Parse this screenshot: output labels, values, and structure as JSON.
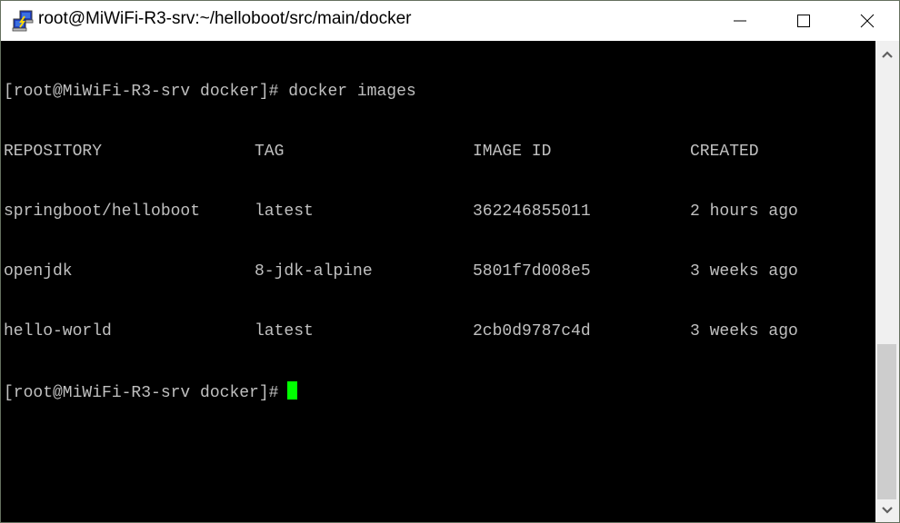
{
  "window": {
    "title": "root@MiWiFi-R3-srv:~/helloboot/src/main/docker",
    "app_icon": "network-computers-icon",
    "controls": {
      "minimize": "minimize-icon",
      "maximize": "maximize-icon",
      "close": "close-icon"
    }
  },
  "terminal": {
    "colors": {
      "background": "#000000",
      "text": "#c0c0c0",
      "cursor": "#00ff00"
    },
    "command_line": {
      "prompt": "[root@MiWiFi-R3-srv docker]#",
      "command": "docker images"
    },
    "table": {
      "headers": [
        "REPOSITORY",
        "TAG",
        "IMAGE ID",
        "CREATED"
      ],
      "rows": [
        [
          "springboot/helloboot",
          "latest",
          "362246855011",
          "2 hours ago"
        ],
        [
          "openjdk",
          "8-jdk-alpine",
          "5801f7d008e5",
          "3 weeks ago"
        ],
        [
          "hello-world",
          "latest",
          "2cb0d9787c4d",
          "3 weeks ago"
        ]
      ]
    },
    "current_prompt": "[root@MiWiFi-R3-srv docker]#"
  },
  "scrollbar": {
    "up": "chevron-up-icon",
    "down": "chevron-down-icon",
    "position_fraction": 0.65
  }
}
